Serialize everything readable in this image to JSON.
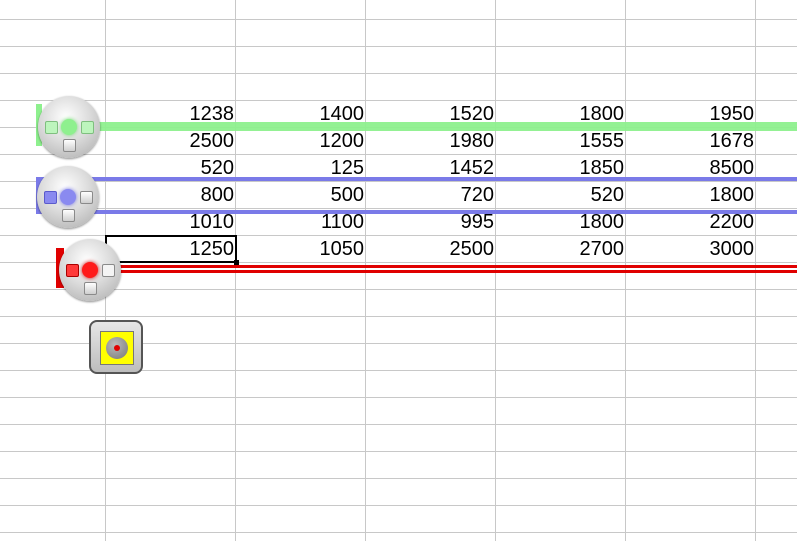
{
  "sheet": {
    "rows": [
      [
        "1238",
        "1400",
        "1520",
        "1800",
        "1950"
      ],
      [
        "2500",
        "1200",
        "1980",
        "1555",
        "1678"
      ],
      [
        "520",
        "125",
        "1452",
        "1850",
        "8500"
      ],
      [
        "800",
        "500",
        "720",
        "520",
        "1800"
      ],
      [
        "1010",
        "1100",
        "995",
        "1800",
        "2200"
      ],
      [
        "1250",
        "1050",
        "2500",
        "2700",
        "3000"
      ]
    ]
  },
  "colors": {
    "green_highlight": "#8ef08e",
    "blue_highlight": "#7a7ae8",
    "red_highlight": "#e00000",
    "record_button": "#ffff00"
  },
  "widgets": {
    "green_knob_icon": "row-handle-green-icon",
    "blue_knob_icon": "row-handle-blue-icon",
    "red_knob_icon": "row-handle-red-icon",
    "record_icon": "record-icon"
  }
}
